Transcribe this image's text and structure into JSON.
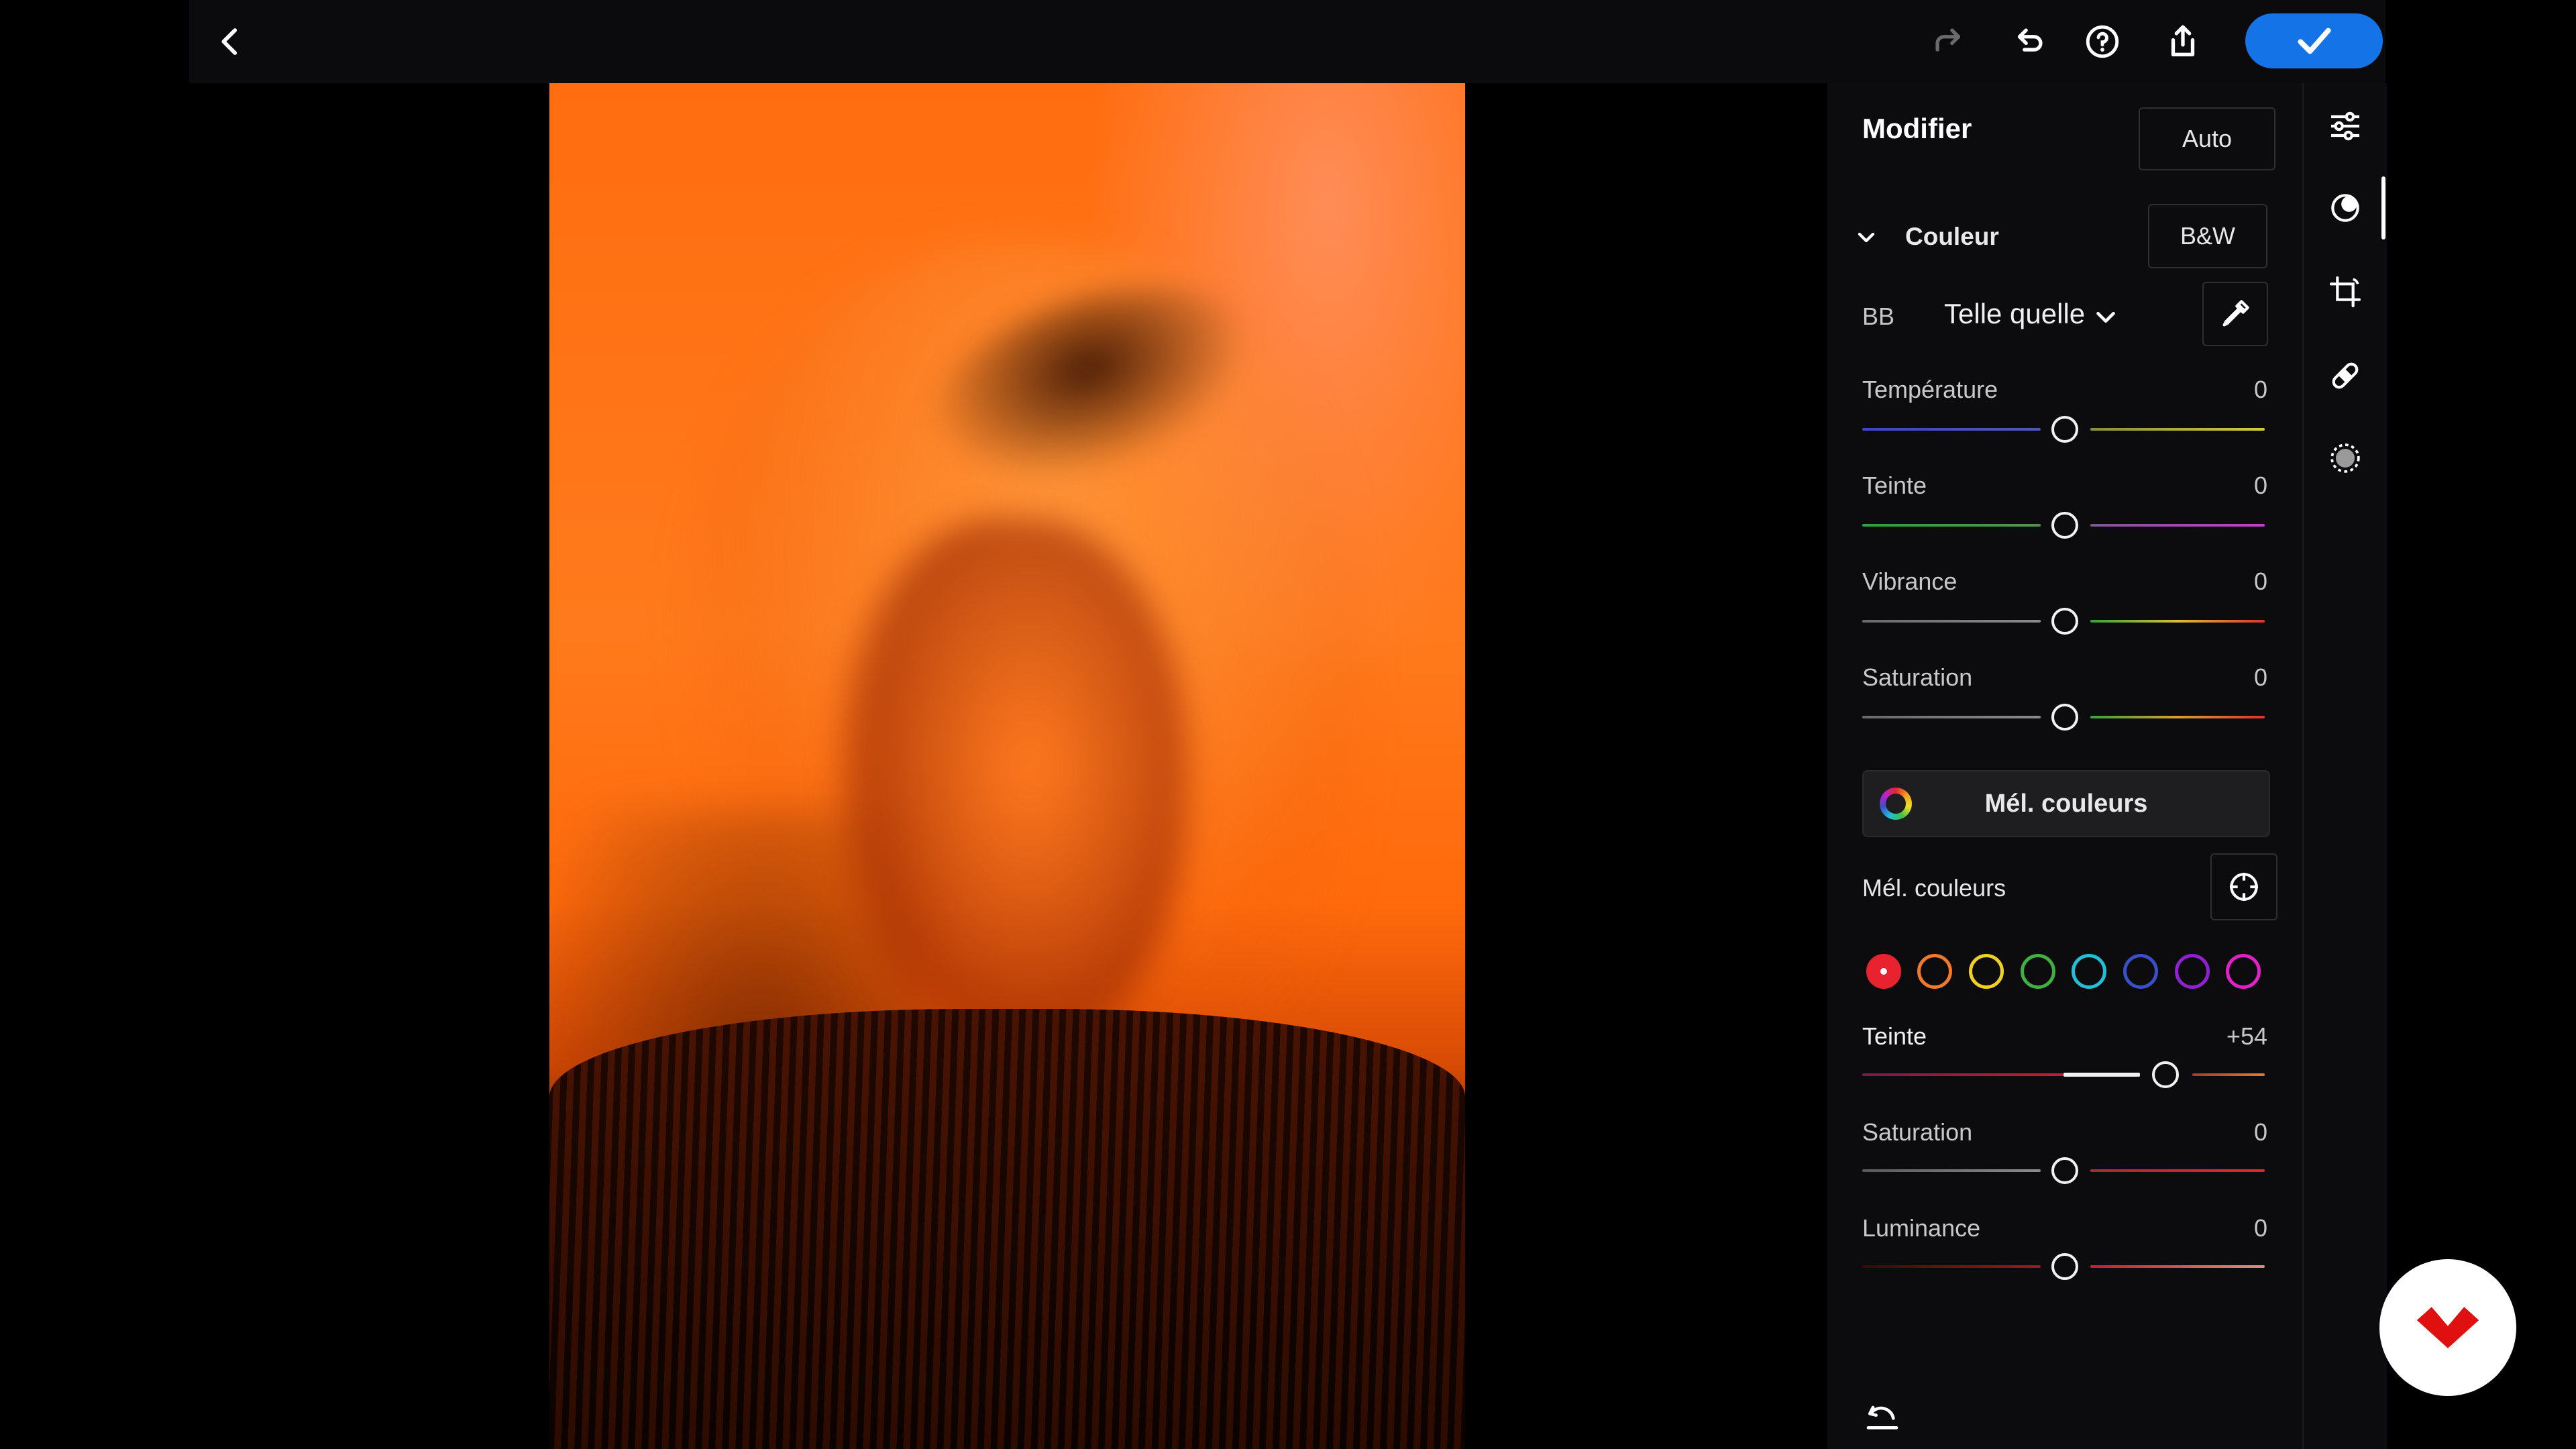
{
  "panel": {
    "title": "Modifier",
    "auto_label": "Auto",
    "color_section": "Couleur",
    "bw_label": "B&W",
    "wb_label": "BB",
    "wb_value": "Telle quelle",
    "sliders": [
      {
        "label": "Température",
        "value": "0"
      },
      {
        "label": "Teinte",
        "value": "0"
      },
      {
        "label": "Vibrance",
        "value": "0"
      },
      {
        "label": "Saturation",
        "value": "0"
      }
    ],
    "mix_button": "Mél. couleurs",
    "mix_title": "Mél. couleurs",
    "mix_swatches": [
      "#e8222e",
      "#f07a2a",
      "#f0d020",
      "#40b040",
      "#20c0d8",
      "#3a50c8",
      "#9020d0",
      "#e020c8"
    ],
    "mix_sliders": [
      {
        "label": "Teinte",
        "value": "+54"
      },
      {
        "label": "Saturation",
        "value": "0"
      },
      {
        "label": "Luminance",
        "value": "0"
      }
    ]
  },
  "colors": {
    "accent": "#1473e6",
    "badge_red": "#e01010"
  },
  "icons": {
    "back": "chevron-left-icon",
    "redo": "redo-icon",
    "undo": "undo-icon",
    "help": "help-icon",
    "share": "share-icon",
    "done": "checkmark-icon",
    "rail": [
      "sliders-icon",
      "presets-icon",
      "crop-icon",
      "heal-icon",
      "mask-icon"
    ],
    "reset": "reset-icon"
  }
}
